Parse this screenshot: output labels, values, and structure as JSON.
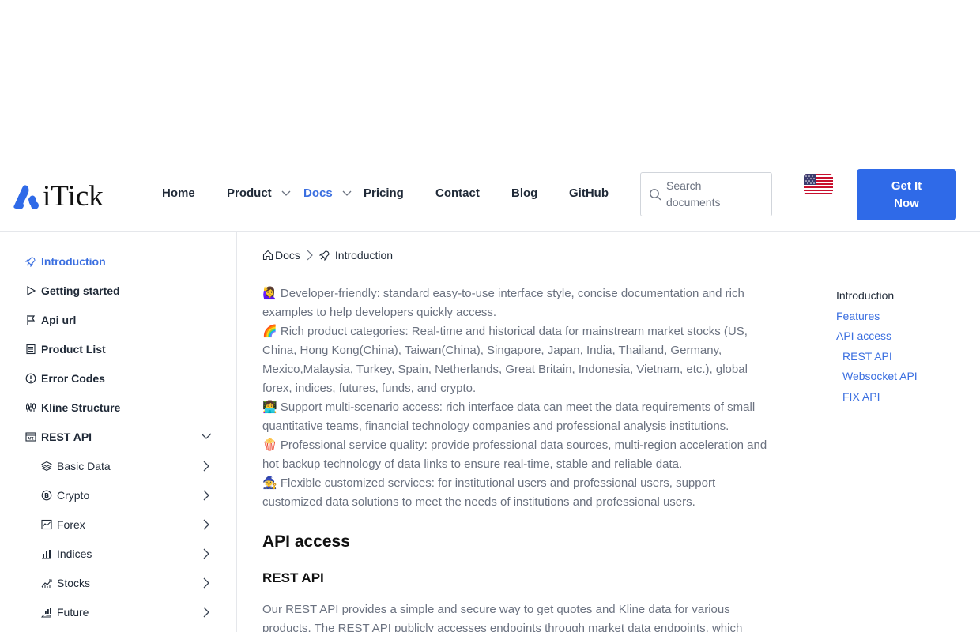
{
  "brand": {
    "name": "iTick",
    "logo_color": "#2f6ae8"
  },
  "nav": {
    "home": "Home",
    "product": "Product",
    "docs": "Docs",
    "pricing": "Pricing",
    "contact": "Contact",
    "blog": "Blog",
    "github": "GitHub"
  },
  "search": {
    "placeholder": "Search documents"
  },
  "language_flag": "us-flag-icon",
  "cta": {
    "label": "Get It Now",
    "color": "#2f6ae8"
  },
  "sidebar": {
    "items": [
      {
        "label": "Introduction",
        "icon": "rocket-icon"
      },
      {
        "label": "Getting started",
        "icon": "play-icon"
      },
      {
        "label": "Api url",
        "icon": "flag-icon"
      },
      {
        "label": "Product List",
        "icon": "list-icon"
      },
      {
        "label": "Error Codes",
        "icon": "alert-icon"
      },
      {
        "label": "Kline Structure",
        "icon": "candles-icon"
      },
      {
        "label": "REST API",
        "icon": "api-icon"
      }
    ],
    "rest_sub": [
      {
        "label": "Basic Data",
        "icon": "layers-icon"
      },
      {
        "label": "Crypto",
        "icon": "bitcoin-icon"
      },
      {
        "label": "Forex",
        "icon": "chart-box-icon"
      },
      {
        "label": "Indices",
        "icon": "bar-chart-icon"
      },
      {
        "label": "Stocks",
        "icon": "trend-icon"
      },
      {
        "label": "Future",
        "icon": "hand-chart-icon"
      }
    ]
  },
  "breadcrumb": {
    "root": "Docs",
    "current": "Introduction"
  },
  "content": {
    "features": [
      {
        "emoji": "🙋‍♀️",
        "text": "Developer-friendly: standard easy-to-use interface style, concise documentation and rich examples to help developers quickly access."
      },
      {
        "emoji": "🌈",
        "text": "Rich product categories: Real-time and historical data for mainstream market stocks (US, China, Hong Kong(China), Taiwan(China), Singapore, Japan, India, Thailand, Germany, Mexico,Malaysia, Turkey, Spain, Netherlands, Great Britain, Indonesia, Vietnam, etc.), global forex, indices, futures, funds, and crypto."
      },
      {
        "emoji": "👩‍💻",
        "text": "Support multi-scenario access: rich interface data can meet the data requirements of small quantitative teams, financial technology companies and professional analysis institutions."
      },
      {
        "emoji": "🍿",
        "text": "Professional service quality: provide professional data sources, multi-region acceleration and hot backup technology of data links to ensure real-time, stable and reliable data."
      },
      {
        "emoji": "🧙",
        "text": "Flexible customized services: for institutional users and professional users, support customized data solutions to meet the needs of institutions and professional users."
      }
    ],
    "api_access_heading": "API access",
    "rest_api_heading": "REST API",
    "rest_api_text": "Our REST API provides a simple and secure way to get quotes and Kline data for various products. The REST API publicly accesses endpoints through market data endpoints, which"
  },
  "toc": {
    "introduction": "Introduction",
    "features": "Features",
    "api_access": "API access",
    "rest_api": "REST API",
    "websocket_api": "Websocket API",
    "fix_api": "FIX API"
  }
}
